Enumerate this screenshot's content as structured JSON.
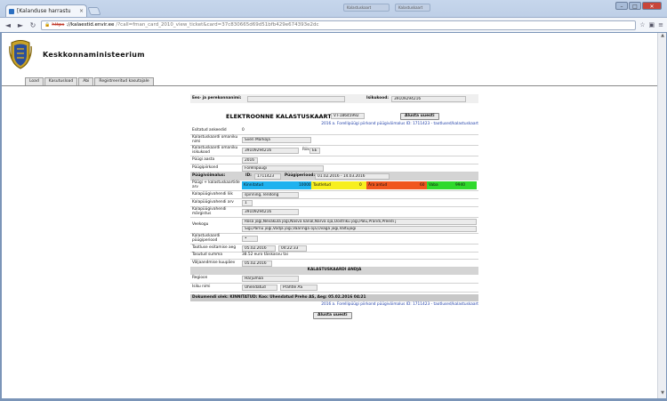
{
  "browser": {
    "tab_title": "[Kalanduse harrastu",
    "tab_close": "×",
    "bg_tab_1": "Kalastuskaart",
    "bg_tab_2": "Kalastuskaart",
    "address": {
      "scheme": "https",
      "host": "://kalaestid.envir.ee",
      "path": "/?call=fman_card_2010_view_ticket&card=37c830665d69d51bfb429e674393e2dc"
    },
    "nav_back": "◄",
    "nav_forward": "►",
    "nav_reload": "↻",
    "win_min": "–",
    "win_max": "□",
    "win_close": "✕"
  },
  "site": {
    "ministry": "Keskkonnaministeerium",
    "tabs": [
      "Load",
      "Kasutusload",
      "Abi",
      "Registreeritud kasutajale"
    ]
  },
  "form": {
    "top_name_label": "Ees- ja perekonnanimi:",
    "top_name_value": "",
    "top_id_label": "Isikukood:",
    "top_id_value": "39109294216",
    "title": "ELEKTROONNE KALASTUSKAART nr",
    "card_no": "VT-18645992",
    "print_btn": "Alusta uuesti",
    "link_top": "2016 a. Forellipüügi piirkond püügivõimalus ID: 1711423 - taotlused/kalastuskaart",
    "rows": {
      "r1_label": "Esitatud ankeedid",
      "r1_value": "0",
      "r2_label": "Kalastuskaardi omaniku nimi",
      "r2_value": "Sven Markoja",
      "r3_label": "Kalastuskaardi omaniku isikukood",
      "r3_value": "39109294216",
      "r3_extra_label": "Riik",
      "r3_extra_value": "EE",
      "r4_label": "Püügi aasta",
      "r4_value": "2016",
      "r5_label": "Püügipiirkond",
      "r5_value": "Forellipüügi",
      "r6_label": "Püügivõimalus:",
      "r6_id_label": "ID:",
      "r6_id_value": "1711423",
      "r6_period_label": "Püügiperiood:",
      "r6_period_value": "01.02.2016 - 14.03.2016",
      "r7_label": "Püügi + kalastuskaartide arv",
      "seg_blue": "Kinnitatud",
      "seg_blue_val": "10000",
      "seg_yellow": "Taotletud",
      "seg_yellow_val": "0",
      "seg_red": "Ära antud",
      "seg_red_val": "60",
      "seg_green": "Vaba",
      "seg_green_val": "9940",
      "r8_label": "Kalapüügivahendi liik",
      "r8_value": "spinning, lendõng",
      "r9_label": "Kalapüügivahendi arv",
      "r9_value": "1",
      "r10_label": "Kalapüügivahendi märgistus",
      "r10_value": "39109294216",
      "r11_label": "Veekogu",
      "r11_value_1": "Rõsa jõgi,Nevaküla jõgi,Nasva kanal,Narva oja,Oostriku jõgi,Palu,Prandi,Preedi j",
      "r11_value_2": "Sigi,Parnu jõgi,Vodja jõgi,Vääringa oja,Ovaga jõgi,Valtujõgi",
      "r12_label": "Kalastuskaardi püügiperiood",
      "r12_value": "•",
      "r13_label": "Taotluse esitamise aeg",
      "r13_date": "05.02.2016",
      "r13_time": "04:22:33",
      "r14_label": "Tasutud summa",
      "r14_value": "38.52 euro  täiskasvu  tai",
      "r15_label": "Väljaandmise kuupäev",
      "r15_value": "05.02.2016",
      "issuer_heading": "KALASTUSKAARDI ANDJA",
      "r16_label": "Regioon",
      "r16_value": "Harjumaa",
      "r17_label": "Isiku nimi",
      "r17_value": "Uhendatud",
      "r17_extra": "Prahtle AS",
      "doc_status": "Dokumendi olek: KINNITATUD: Koo: Uhendatud Preho AS, Aeg: 05.02.2016 04:21",
      "link_bottom": "2016 a. Forellipüügi piirkond püügivõimalus ID: 1711423 - taotlused/kalastuskaart"
    },
    "bottom_btn": "Alusta uuesti"
  },
  "colors": {
    "blue": "#1fb2ef",
    "yellow": "#f7ef1f",
    "red": "#f0561e",
    "green": "#2fd92c"
  }
}
